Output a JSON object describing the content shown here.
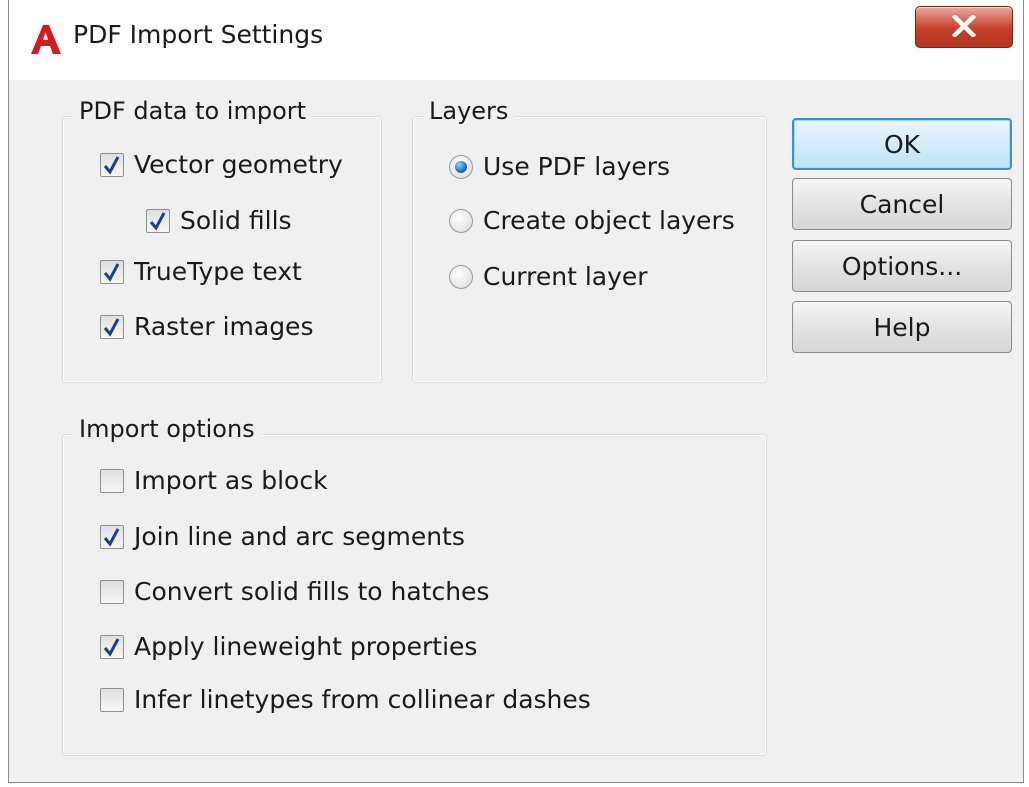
{
  "window": {
    "title": "PDF Import Settings",
    "icon": "autocad-a-icon"
  },
  "groups": {
    "pdf_data": {
      "legend": "PDF data to import",
      "items": [
        {
          "label": "Vector geometry",
          "checked": true
        },
        {
          "label": "Solid fills",
          "checked": true
        },
        {
          "label": "TrueType text",
          "checked": true
        },
        {
          "label": "Raster images",
          "checked": true
        }
      ]
    },
    "layers": {
      "legend": "Layers",
      "options": [
        {
          "label": "Use PDF layers",
          "selected": true
        },
        {
          "label": "Create object layers",
          "selected": false
        },
        {
          "label": "Current layer",
          "selected": false
        }
      ]
    },
    "import_options": {
      "legend": "Import options",
      "items": [
        {
          "label": "Import as block",
          "checked": false
        },
        {
          "label": "Join line and arc segments",
          "checked": true
        },
        {
          "label": "Convert solid fills to hatches",
          "checked": false
        },
        {
          "label": "Apply lineweight properties",
          "checked": true
        },
        {
          "label": "Infer linetypes from collinear dashes",
          "checked": false
        }
      ]
    }
  },
  "buttons": {
    "ok": "OK",
    "cancel": "Cancel",
    "options": "Options...",
    "help": "Help"
  },
  "colors": {
    "accent": "#3c8fd6",
    "close_button": "#c7402a",
    "app_icon": "#d71920"
  }
}
